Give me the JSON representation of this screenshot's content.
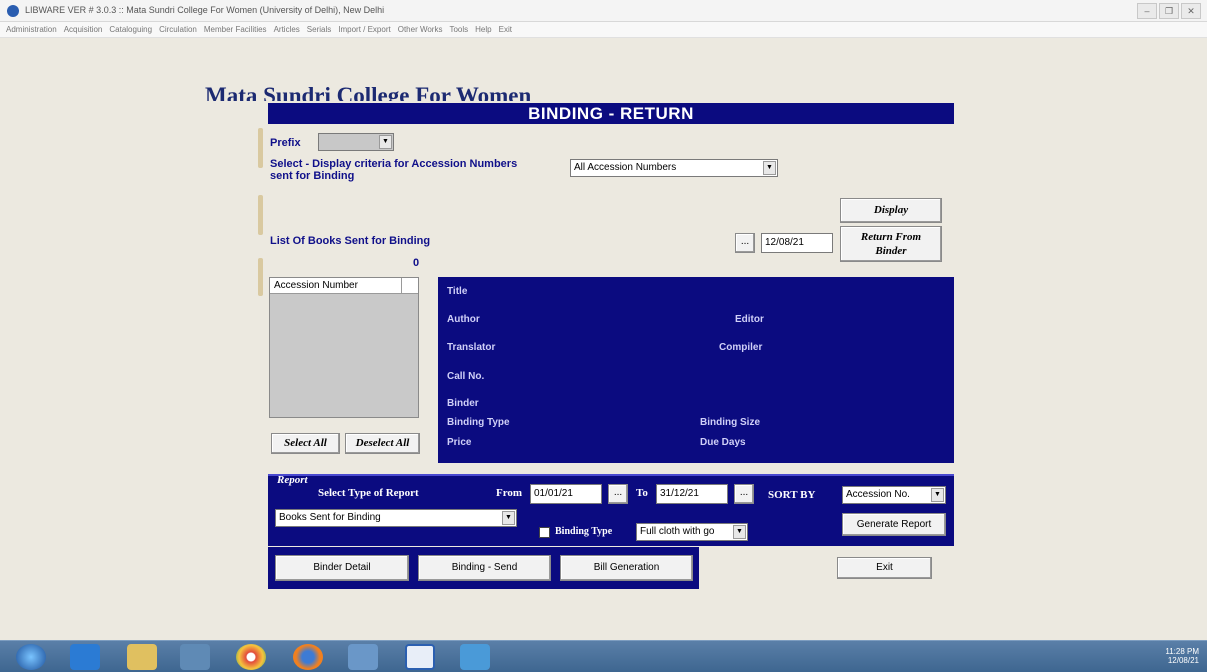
{
  "window": {
    "title": "LIBWARE VER # 3.0.3 :: Mata Sundri College For Women (University of Delhi), New Delhi",
    "controls": [
      "–",
      "❐",
      "✕"
    ]
  },
  "menu": [
    "Administration",
    "Acquisition",
    "Cataloguing",
    "Circulation",
    "Member Facilities",
    "Articles",
    "Serials",
    "Import / Export",
    "Other Works",
    "Tools",
    "Help",
    "Exit"
  ],
  "college_name": "Mata Sundri College For Women",
  "form": {
    "header": "BINDING - RETURN",
    "prefix_label": "Prefix",
    "prefix_value": "",
    "criteria_label_line1": "Select - Display criteria for Accession Numbers",
    "criteria_label_line2": "sent for Binding",
    "criteria_value": "All Accession Numbers",
    "display_button": "Display",
    "list_label": "List Of Books Sent for Binding",
    "count": "0",
    "date_button": "...",
    "date_value": "12/08/21",
    "return_button_line1": "Return From",
    "return_button_line2": "Binder",
    "list_header": "Accession Number",
    "select_all": "Select All",
    "deselect_all": "Deselect All"
  },
  "details": {
    "title": "Title",
    "author": "Author",
    "editor": "Editor",
    "translator": "Translator",
    "compiler": "Compiler",
    "call_no": "Call No.",
    "binder": "Binder",
    "binding_type": "Binding Type",
    "binding_size": "Binding Size",
    "price": "Price",
    "due_days": "Due Days"
  },
  "report": {
    "title": "Report",
    "select_type_label": "Select Type of Report",
    "type_value": "Books Sent for Binding",
    "from_label": "From",
    "from_value": "01/01/21",
    "to_label": "To",
    "to_value": "31/12/21",
    "picker": "...",
    "sort_by_label": "SORT BY",
    "sort_value": "Accession No.",
    "binding_type_label": "Binding Type",
    "binding_type_value": "Full cloth with go",
    "generate_button": "Generate Report"
  },
  "bottom": {
    "binder_detail": "Binder Detail",
    "binding_send": "Binding - Send",
    "bill_generation": "Bill Generation",
    "exit": "Exit"
  },
  "tray": {
    "time": "11:28 PM",
    "date": "12/08/21"
  }
}
